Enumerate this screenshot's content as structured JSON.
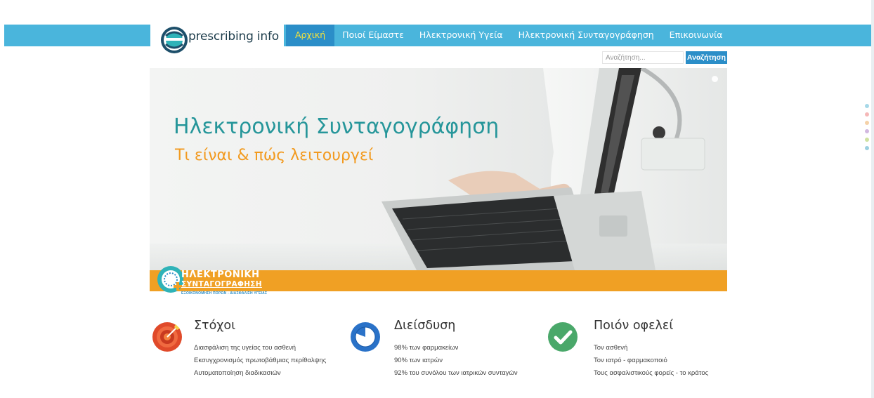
{
  "brand": {
    "name": "prescribing info",
    "colors": {
      "bar": "#4ab5dc",
      "accent": "#2b8ec8",
      "active_text": "#f4e23b",
      "teal": "#26969a",
      "orange": "#f0a024"
    }
  },
  "nav": {
    "items": [
      {
        "label": "Αρχική",
        "active": true
      },
      {
        "label": "Ποιοί Είμαστε",
        "active": false
      },
      {
        "label": "Ηλεκτρονική Υγεία",
        "active": false
      },
      {
        "label": "Ηλεκτρονική Συνταγογράφηση",
        "active": false
      },
      {
        "label": "Επικοινωνία",
        "active": false
      }
    ]
  },
  "search": {
    "placeholder": "Αναζήτηση...",
    "button_label": "Αναζήτηση"
  },
  "hero": {
    "title": "Ηλεκτρονική Συνταγογράφηση",
    "subtitle": "Τι είναι & πώς λειτουργεί",
    "badge_line1": "ΗΛΕΚΤΡΟΝΙΚΗ",
    "badge_line2": "ΣΥΝΤΑΓΟΓΡΑΦΗΣΗ",
    "badge_small": "ΕΞΟΙΚΟΝΟΜΗΣΗ ΠΟΡΩΝ - ΔΙΑΣΦΑΛΙΣΗ ΥΓΕΙΑΣ"
  },
  "side_dots": [
    "#a6d8e8",
    "#f5b8b8",
    "#f5d2a8",
    "#d2b8e0",
    "#cfe2a0",
    "#9cd0e0"
  ],
  "features": [
    {
      "title": "Στόχοι",
      "icon": "target-icon",
      "items": [
        "Διασφάλιση της υγείας του ασθενή",
        "Εκσυγχρονισμός πρωτοβάθμιας περίθαλψης",
        "Αυτοματοποίηση διαδικασιών"
      ]
    },
    {
      "title": "Διείσδυση",
      "icon": "pie-chart-icon",
      "items": [
        "98% των φαρμακείων",
        "90% των ιατρών",
        "92% του συνόλου των ιατρικών συνταγών"
      ]
    },
    {
      "title": "Ποιόν οφελεί",
      "icon": "checkmark-icon",
      "items": [
        "Τον ασθενή",
        "Τον ιατρό - φαρμακοποιό",
        "Τους ασφαλιστικούς φορείς  - το κράτος"
      ]
    }
  ]
}
